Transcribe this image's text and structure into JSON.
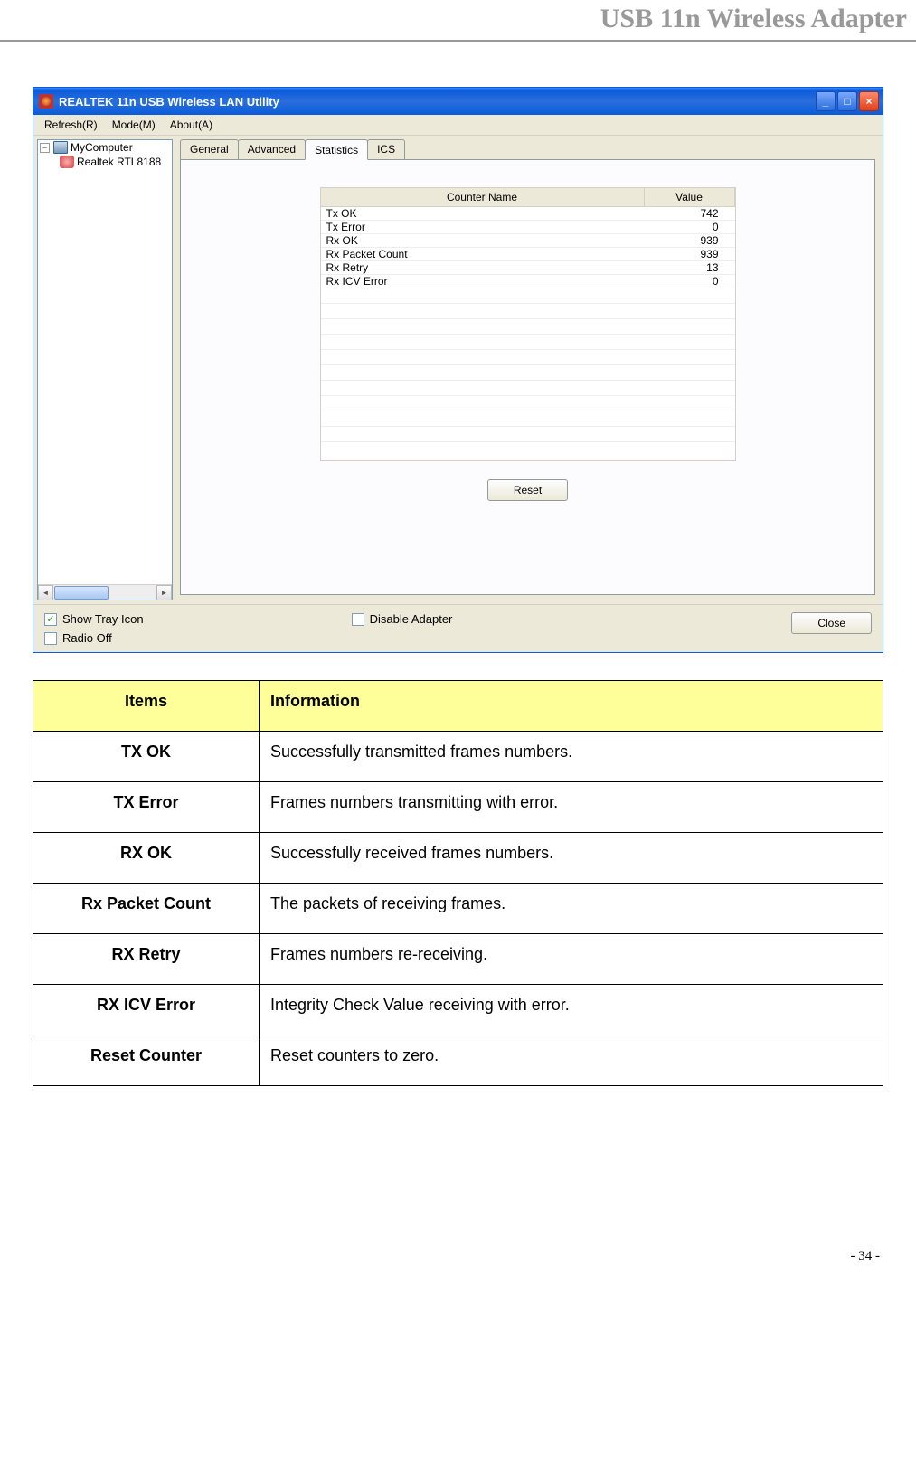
{
  "header_title": "USB 11n Wireless Adapter",
  "page_number": "- 34 -",
  "window": {
    "title": "REALTEK 11n USB Wireless LAN Utility",
    "menu": {
      "refresh": "Refresh(R)",
      "mode": "Mode(M)",
      "about": "About(A)"
    },
    "tree": {
      "mycomputer": "MyComputer",
      "realtek": "Realtek RTL8188"
    },
    "tabs": {
      "general": "General",
      "advanced": "Advanced",
      "statistics": "Statistics",
      "ics": "ICS"
    },
    "stats": {
      "header_name": "Counter Name",
      "header_value": "Value",
      "rows": [
        {
          "name": "Tx OK",
          "value": "742"
        },
        {
          "name": "Tx Error",
          "value": "0"
        },
        {
          "name": "Rx OK",
          "value": "939"
        },
        {
          "name": "Rx Packet Count",
          "value": "939"
        },
        {
          "name": "Rx Retry",
          "value": "13"
        },
        {
          "name": "Rx ICV Error",
          "value": "0"
        }
      ],
      "reset_button": "Reset"
    },
    "bottom": {
      "show_tray": "Show Tray Icon",
      "radio_off": "Radio Off",
      "disable_adapter": "Disable Adapter",
      "close": "Close"
    }
  },
  "info_table": {
    "header_items": "Items",
    "header_info": "Information",
    "rows": [
      {
        "item": "TX OK",
        "info": "Successfully transmitted frames numbers."
      },
      {
        "item": "TX Error",
        "info": "Frames numbers transmitting with error."
      },
      {
        "item": "RX OK",
        "info": "Successfully received frames numbers."
      },
      {
        "item": "Rx Packet Count",
        "info": "The packets of receiving frames."
      },
      {
        "item": "RX Retry",
        "info": "Frames numbers re-receiving."
      },
      {
        "item": "RX ICV Error",
        "info": "Integrity Check Value receiving with error."
      },
      {
        "item": "Reset Counter",
        "info": "Reset counters to zero."
      }
    ]
  }
}
